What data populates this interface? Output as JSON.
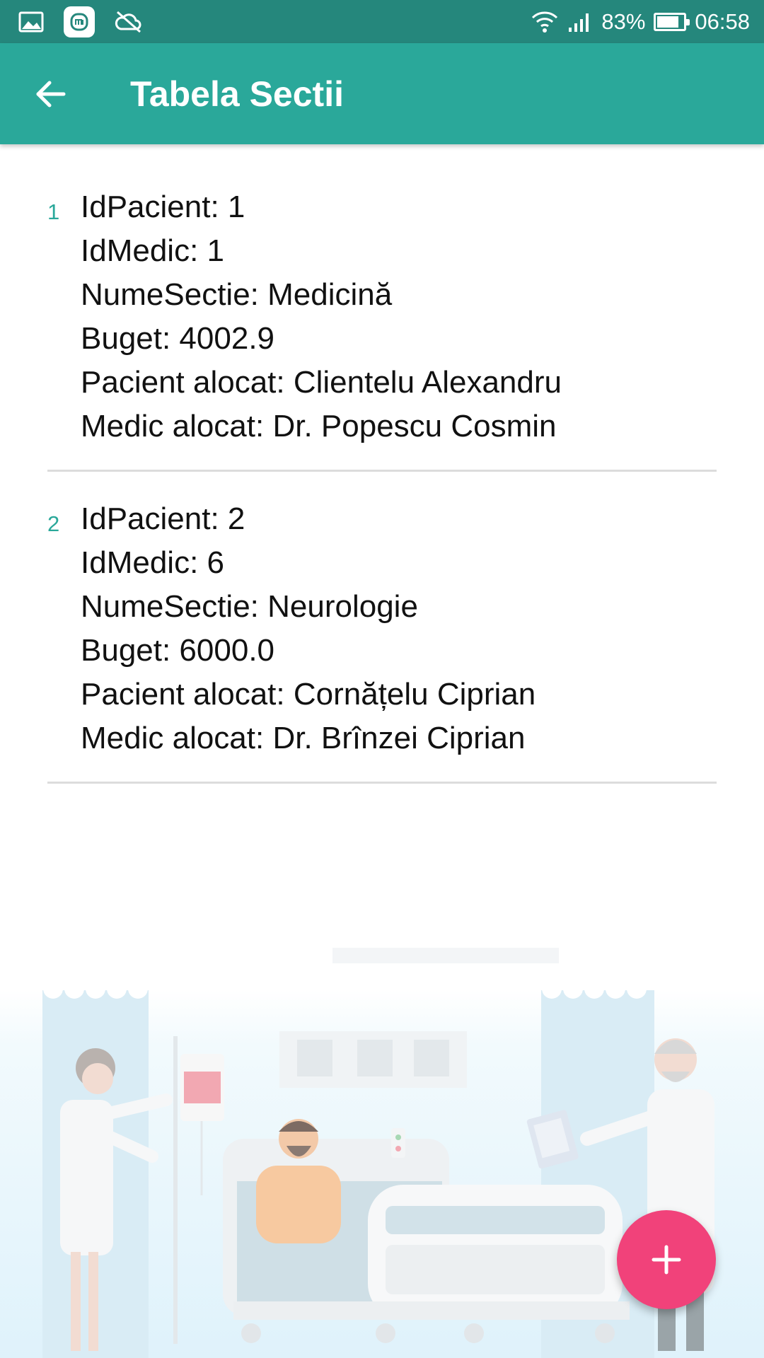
{
  "status_bar": {
    "battery_percent": "83%",
    "battery_level": 0.83,
    "time": "06:58",
    "left_icons": [
      "gallery-icon",
      "mi-icon",
      "cloud-off-icon"
    ],
    "right_icons": [
      "wifi-icon",
      "signal-icon",
      "battery-icon"
    ]
  },
  "app_bar": {
    "title": "Tabela Sectii",
    "back_icon": "arrow-back-icon"
  },
  "list": {
    "items": [
      {
        "index": "1",
        "lines": [
          "IdPacient: 1",
          "IdMedic: 1",
          "NumeSectie: Medicină",
          "Buget: 4002.9",
          "Pacient alocat: Clientelu Alexandru",
          "Medic alocat: Dr. Popescu Cosmin"
        ]
      },
      {
        "index": "2",
        "lines": [
          "IdPacient: 2",
          "IdMedic: 6",
          "NumeSectie: Neurologie",
          "Buget: 6000.0",
          "Pacient alocat: Cornățelu Ciprian",
          "Medic alocat: Dr. Brînzei Ciprian"
        ]
      }
    ]
  },
  "fab": {
    "icon": "plus-icon"
  },
  "colors": {
    "status_bar": "#25877c",
    "app_bar": "#2aa89a",
    "accent": "#2aa89a",
    "fab": "#f1427a",
    "divider": "#dcdcdc"
  }
}
